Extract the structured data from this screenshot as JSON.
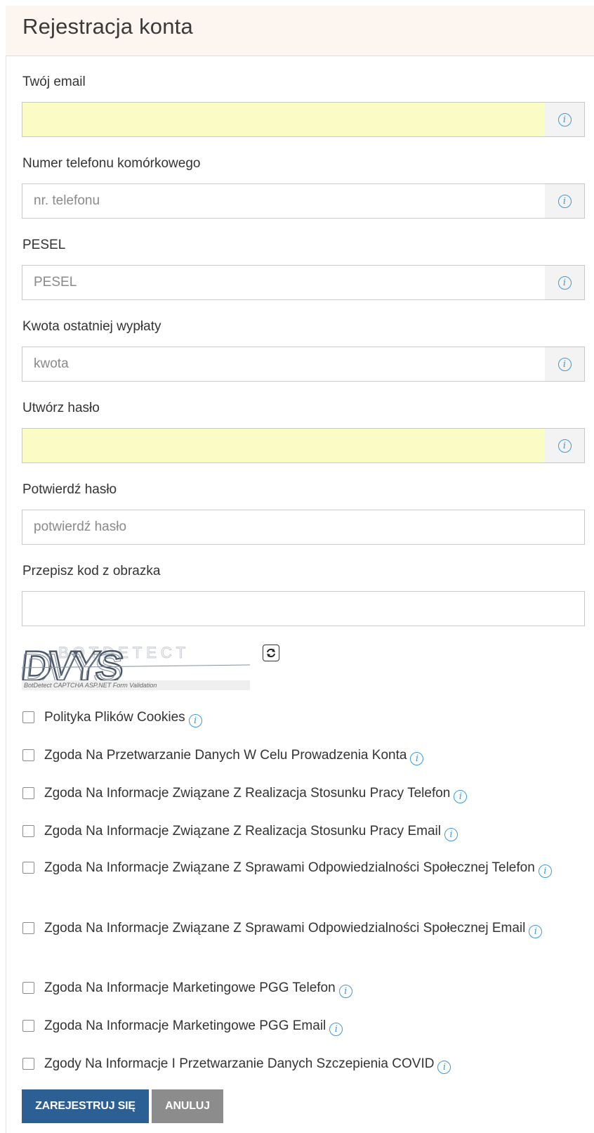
{
  "header": {
    "title": "Rejestracja konta"
  },
  "fields": [
    {
      "label": "Twój email",
      "value": "",
      "placeholder": ""
    },
    {
      "label": "Numer telefonu komórkowego",
      "value": "",
      "placeholder": "nr. telefonu"
    },
    {
      "label": "PESEL",
      "value": "",
      "placeholder": "PESEL"
    },
    {
      "label": "Kwota ostatniej wypłaty",
      "value": "",
      "placeholder": "kwota"
    },
    {
      "label": "Utwórz hasło",
      "value": "",
      "placeholder": ""
    },
    {
      "label": "Potwierdź hasło",
      "value": "",
      "placeholder": "potwierdź hasło"
    },
    {
      "label": "Przepisz kod z obrazka",
      "value": "",
      "placeholder": ""
    }
  ],
  "info_icon_glyph": "i",
  "captcha": {
    "code": "DVYS",
    "caption": "BotDetect CAPTCHA ASP.NET Form Validation",
    "refresh_icon": "refresh-icon"
  },
  "consents": [
    {
      "label": "Polityka Plików Cookies",
      "checked": false
    },
    {
      "label": "Zgoda Na Przetwarzanie Danych W Celu Prowadzenia Konta",
      "checked": false
    },
    {
      "label": "Zgoda Na Informacje Związane Z Realizacja Stosunku Pracy Telefon",
      "checked": false
    },
    {
      "label": "Zgoda Na Informacje Związane Z Realizacja Stosunku Pracy Email",
      "checked": false
    },
    {
      "label": "Zgoda Na Informacje Związane Z Sprawami Odpowiedzialności Społecznej Telefon",
      "checked": false
    },
    {
      "label": "Zgoda Na Informacje Związane Z Sprawami Odpowiedzialności Społecznej Email",
      "checked": false
    },
    {
      "label": "Zgoda Na Informacje Marketingowe PGG Telefon",
      "checked": false
    },
    {
      "label": "Zgoda Na Informacje Marketingowe PGG Email",
      "checked": false
    },
    {
      "label": "Zgody Na Informacje I Przetwarzanie Danych Szczepienia COVID",
      "checked": false
    }
  ],
  "buttons": {
    "register": "ZAREJESTRUJ SIĘ",
    "cancel": "ANULUJ"
  },
  "colors": {
    "header_bg": "#fdf5f0",
    "autofill_bg": "#fbfbc5",
    "info_blue": "#3b9ad9",
    "primary_button": "#2c5f93",
    "secondary_button": "#8c8c8c"
  }
}
